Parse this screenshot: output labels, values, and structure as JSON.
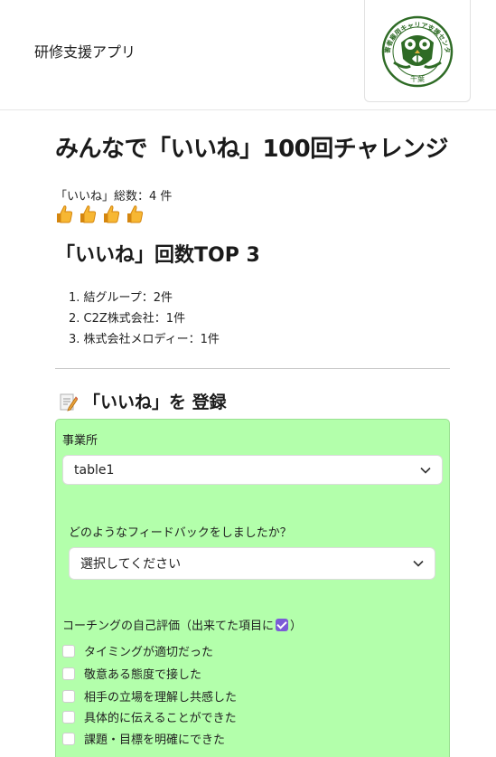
{
  "header": {
    "app_title": "研修支援アプリ",
    "logo": {
      "arc_text": "障害者雇用キャリア支援センター",
      "bottom_text": "千葉",
      "icon": "owl-logo",
      "color": "#2e6b25"
    }
  },
  "main": {
    "title": "みんなで「いいね」100回チャレンジ",
    "total_line": "「いいね」総数：4 件",
    "thumbs_count": 4,
    "thumb_icon": "thumbs-up-icon",
    "ranking_title": "「いいね」回数TOP 3",
    "ranking": [
      "結グループ：2件",
      "C2Z株式会社：1件",
      "株式会社メロディー：1件"
    ]
  },
  "register": {
    "icon": "memo-icon",
    "title": "「いいね」を 登録",
    "panel_color": "#b3ffab",
    "office_label": "事業所",
    "office_value": "table1",
    "feedback_label": "どのようなフィードバックをしましたか？",
    "feedback_value": "選択してください",
    "self_eval_label_pre": "コーチングの自己評価（出来てた項目に",
    "self_eval_label_post": "）",
    "checkboxes": [
      "タイミングが適切だった",
      "敬意ある態度で接した",
      "相手の立場を理解し共感した",
      "具体的に伝えることができた",
      "課題・目標を明確にできた"
    ]
  }
}
